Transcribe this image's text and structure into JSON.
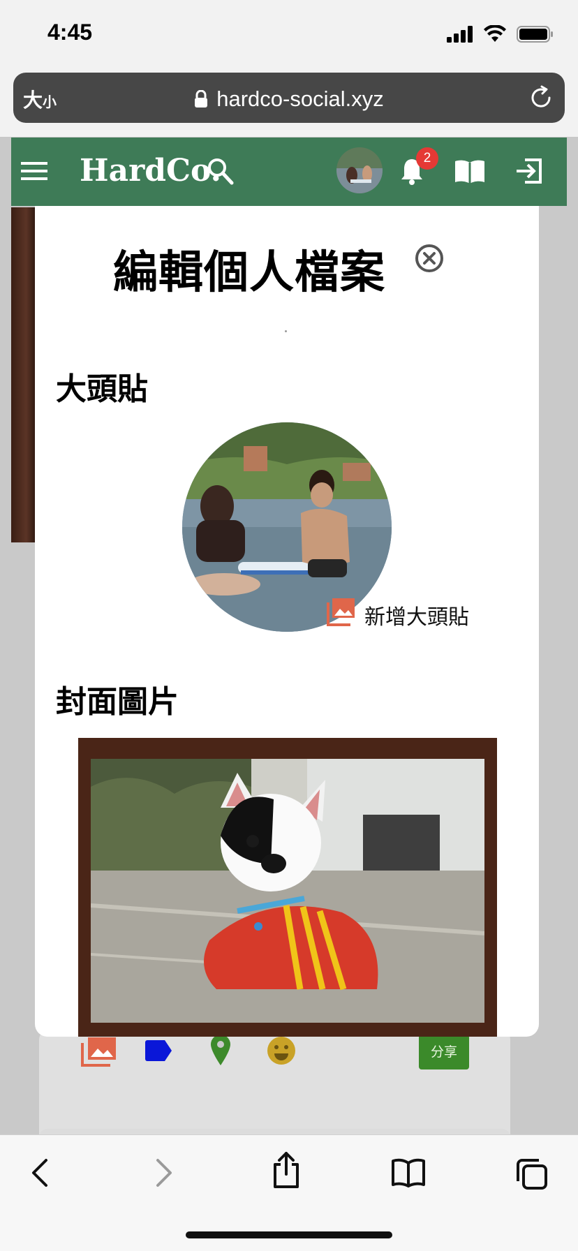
{
  "status_bar": {
    "time": "4:45"
  },
  "browser": {
    "text_size": "大",
    "text_size_small": "小",
    "url": "hardco-social.xyz"
  },
  "app": {
    "brand": "HardCo.",
    "notification_count": "2",
    "brand_color": "#3e7b57"
  },
  "modal": {
    "title": "編輯個人檔案",
    "avatar_section": "大頭貼",
    "add_avatar_label": "新增大頭貼",
    "cover_section": "封面圖片"
  },
  "post_toolbar": {
    "share_label": "分享",
    "icons": [
      "photo-library-icon",
      "label-tag-icon",
      "location-pin-icon",
      "emoji-icon"
    ]
  },
  "colors": {
    "photo_icon": "#e0664a",
    "tag_icon": "#0a17d8",
    "pin_icon": "#3d8a2b",
    "emoji_icon": "#c9a227",
    "share_button": "#3b8a2a"
  }
}
